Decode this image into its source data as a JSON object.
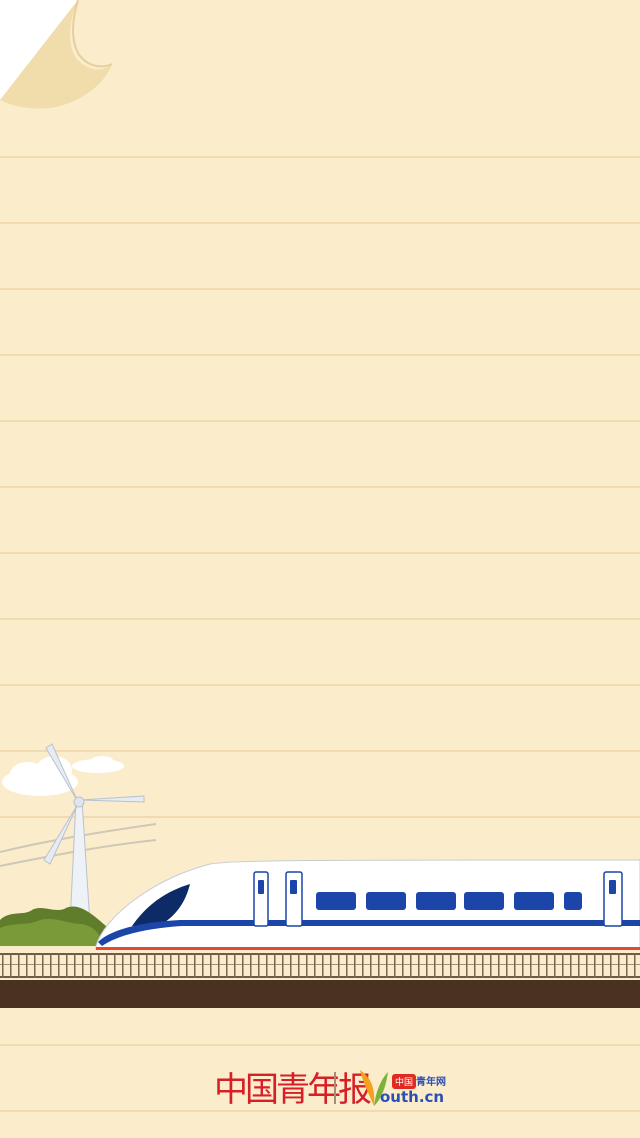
{
  "logos": {
    "newspaper": "中国青年报",
    "site_badge": "中国",
    "site_name_cn": "青年网",
    "site_domain": "outh.cn"
  },
  "colors": {
    "paper": "#fbeccb",
    "line": "#efd8ac",
    "brand_red": "#d61f26",
    "brand_blue": "#2b4fb5",
    "train_blue": "#1b45a8",
    "train_red": "#e8472f",
    "ground": "#4a3222"
  },
  "icons": [
    "folded-corner",
    "wind-turbine-icon",
    "high-speed-train-icon",
    "cloud-icon",
    "grass-icon",
    "rail-fence-icon",
    "youth-leaf-icon"
  ]
}
